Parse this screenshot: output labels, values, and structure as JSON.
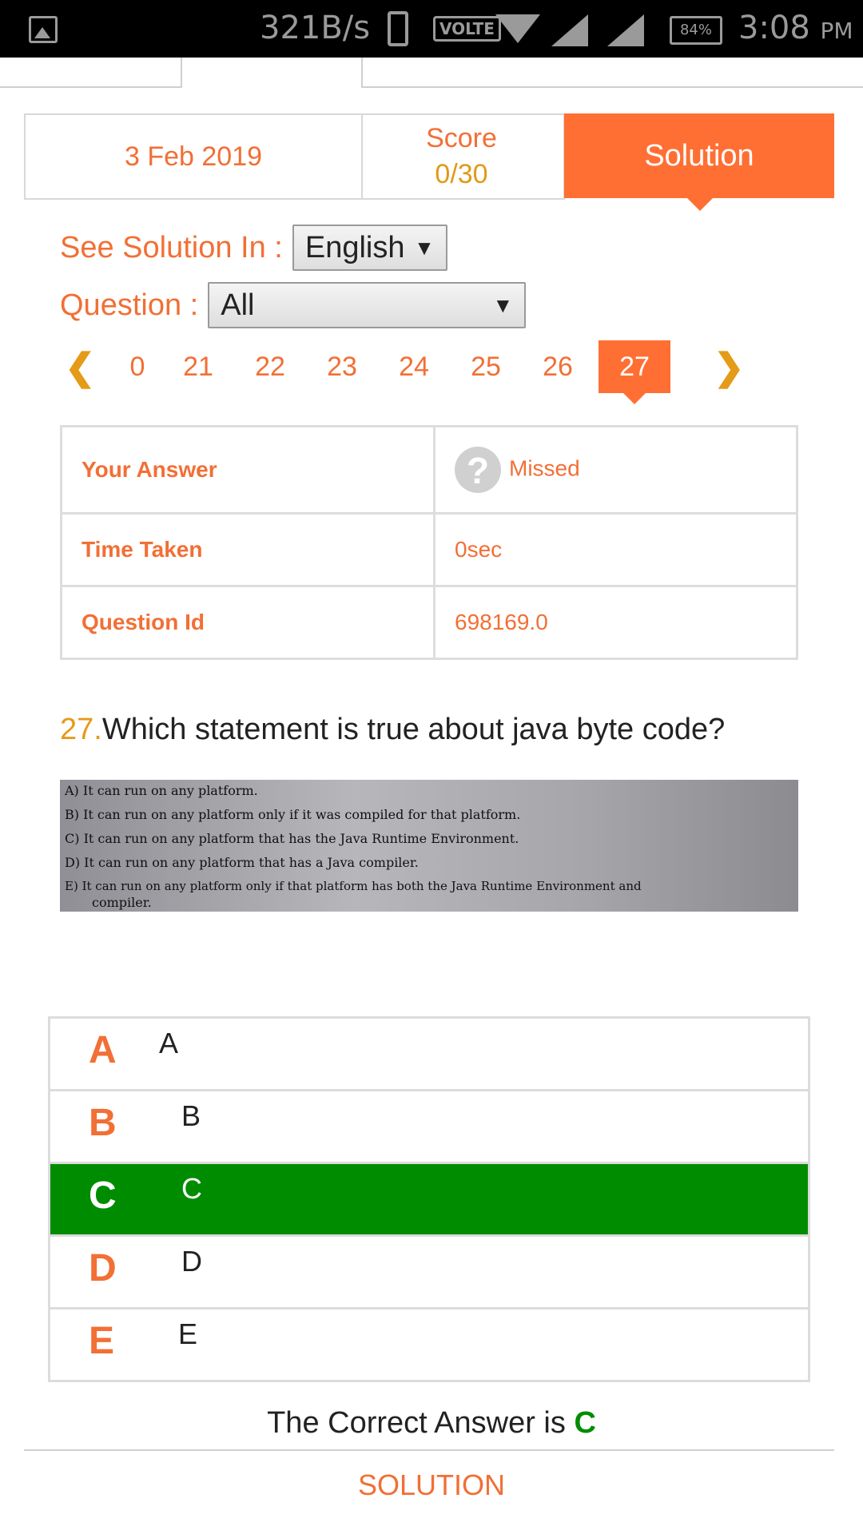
{
  "status_bar": {
    "speed": "321B/s",
    "volte": "VOLTE",
    "battery": "84%",
    "time": "3:08",
    "ampm": "PM",
    "icons": [
      "image-icon",
      "phone-icon",
      "wifi-icon",
      "signal-icon",
      "signal-icon",
      "battery-icon"
    ]
  },
  "header": {
    "date": "3 Feb 2019",
    "score_label": "Score",
    "score_value": "0/30",
    "solution_tab": "Solution"
  },
  "language": {
    "label": "See Solution In :",
    "selected": "English"
  },
  "question_filter": {
    "label": "Question :",
    "selected": "All"
  },
  "pager": {
    "numbers": [
      "0",
      "21",
      "22",
      "23",
      "24",
      "25",
      "26",
      "27"
    ],
    "active": "27"
  },
  "info": {
    "your_answer_label": "Your Answer",
    "your_answer_value": "Missed",
    "time_taken_label": "Time Taken",
    "time_taken_value": "0sec",
    "question_id_label": "Question Id",
    "question_id_value": "698169.0"
  },
  "question": {
    "number": "27.",
    "text": "Which statement is true about java byte code?",
    "image_lines": [
      "A) It can run on any platform.",
      "B) It can run on any platform only if it was compiled for that platform.",
      "C) It can run on any platform that has the Java Runtime Environment.",
      "D) It can run on any platform that has a Java compiler.",
      "E) It can run on any platform only if that platform has both the Java Runtime Environment and",
      "compiler."
    ]
  },
  "options": [
    {
      "letter": "A",
      "text": "A"
    },
    {
      "letter": "B",
      "text": "B"
    },
    {
      "letter": "C",
      "text": "C"
    },
    {
      "letter": "D",
      "text": "D"
    },
    {
      "letter": "E",
      "text": "E"
    }
  ],
  "correct": {
    "prefix": "The Correct Answer is",
    "answer": "C"
  },
  "solution_link": "SOLUTION",
  "colors": {
    "accent": "#ff6f33",
    "text_orange": "#f26f35",
    "gold": "#e59b18",
    "correct_green": "#008c00"
  }
}
